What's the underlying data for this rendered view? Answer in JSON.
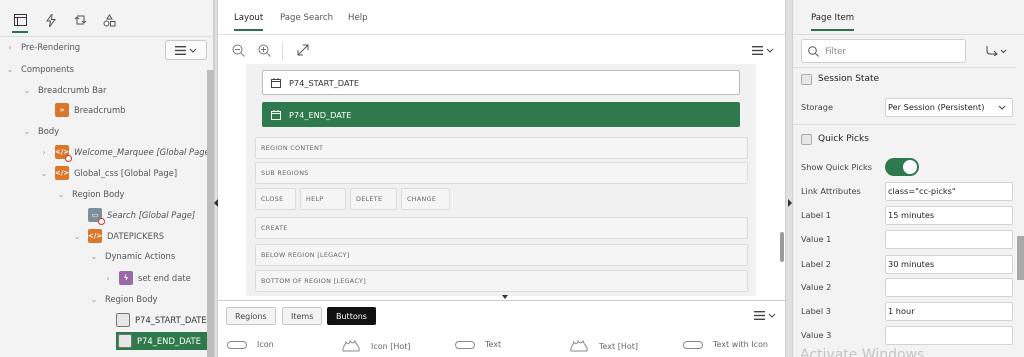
{
  "left_tabs": [
    "rendering-tab",
    "dynamic-actions-tab",
    "processing-tab",
    "shared-components-tab"
  ],
  "tree": {
    "menu_icon": "list-icon",
    "nodes": [
      {
        "label": "Pre-Rendering"
      },
      {
        "label": "Components"
      },
      {
        "label": "Breadcrumb Bar"
      },
      {
        "label": "Breadcrumb"
      },
      {
        "label": "Body"
      },
      {
        "label": "Welcome_Marquee [Global Page]"
      },
      {
        "label": "Global_css [Global Page]"
      },
      {
        "label": "Region Body"
      },
      {
        "label": "Search [Global Page]"
      },
      {
        "label": "DATEPICKERS"
      },
      {
        "label": "Dynamic Actions"
      },
      {
        "label": "set end date"
      },
      {
        "label": "Region Body"
      },
      {
        "label": "P74_START_DATE"
      },
      {
        "label": "P74_END_DATE"
      }
    ]
  },
  "center": {
    "tabs": [
      "Layout",
      "Page Search",
      "Help"
    ],
    "items": [
      "P74_START_DATE",
      "P74_END_DATE"
    ],
    "positions": {
      "region_content": "REGION CONTENT",
      "sub_regions": "SUB REGIONS",
      "buttons": [
        "CLOSE",
        "HELP",
        "DELETE",
        "CHANGE"
      ],
      "create": "CREATE",
      "below_region": "BELOW REGION [LEGACY]",
      "bottom_region": "BOTTOM OF REGION [LEGACY]"
    },
    "gallery_tabs": [
      "Regions",
      "Items",
      "Buttons"
    ],
    "gallery_items": [
      "Icon",
      "Icon [Hot]",
      "Text",
      "Text [Hot]",
      "Text with Icon"
    ]
  },
  "right": {
    "tab": "Page Item",
    "filter_placeholder": "Filter",
    "session_state": {
      "title": "Session State",
      "storage_label": "Storage",
      "storage_value": "Per Session (Persistent)"
    },
    "quick_picks": {
      "title": "Quick Picks",
      "show_label": "Show Quick Picks",
      "show_enabled": true,
      "rows": [
        {
          "label": "Link Attributes",
          "value": "class=\"cc-picks\""
        },
        {
          "label": "Label 1",
          "value": "15 minutes"
        },
        {
          "label": "Value 1",
          "value": ""
        },
        {
          "label": "Label 2",
          "value": "30 minutes"
        },
        {
          "label": "Value 2",
          "value": ""
        },
        {
          "label": "Label 3",
          "value": "1 hour"
        },
        {
          "label": "Value 3",
          "value": ""
        }
      ]
    },
    "watermark": "Activate Windows"
  },
  "colors": {
    "accent": "#2f7a4c",
    "item_orange": "#d9772b",
    "item_purple": "#9a6aa8"
  }
}
